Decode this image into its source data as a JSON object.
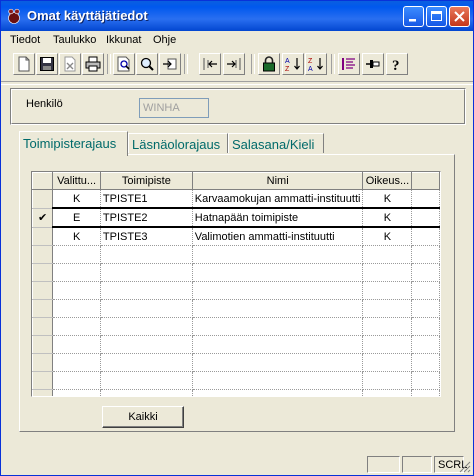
{
  "window": {
    "title": "Omat käyttäjätiedot",
    "colors": {
      "titlebar": "#0058ee",
      "tab_text": "#006a6a",
      "face": "#ece9d8"
    }
  },
  "menu": {
    "items": [
      {
        "label": "Tiedot"
      },
      {
        "label": "Taulukko"
      },
      {
        "label": "Ikkunat"
      },
      {
        "label": "Ohje"
      }
    ]
  },
  "toolbar": {
    "icons": [
      "new-icon",
      "save-icon",
      "delete-icon",
      "print-icon",
      "print-preview-icon",
      "zoom-icon",
      "goto-icon",
      "import-icon",
      "export-icon",
      "lock-icon",
      "sort-ascending-icon",
      "sort-descending-icon",
      "list-icon",
      "pin-icon",
      "help-icon"
    ]
  },
  "henkilo": {
    "label": "Henkilö",
    "value": "WINHA"
  },
  "tabs": [
    {
      "label": "Toimipisterajaus",
      "active": true
    },
    {
      "label": "Läsnäolorajaus",
      "active": false
    },
    {
      "label": "Salasana/Kieli",
      "active": false
    }
  ],
  "grid": {
    "columns": [
      "Valittu...",
      "Toimipiste",
      "Nimi",
      "Oikeus..."
    ],
    "rows": [
      {
        "indicator": "",
        "valittu": "K",
        "toimipiste": "TPISTE1",
        "nimi": "Karvaamokujan ammatti-instituutti",
        "oikeus": "K"
      },
      {
        "indicator": "✔",
        "valittu": "E",
        "toimipiste": "TPISTE2",
        "nimi": "Hatnapään toimipiste",
        "oikeus": "K"
      },
      {
        "indicator": "",
        "valittu": "K",
        "toimipiste": "TPISTE3",
        "nimi": "Valimotien ammatti-instituutti",
        "oikeus": "K"
      }
    ],
    "empty_rows": 10
  },
  "buttons": {
    "kaikki": "Kaikki"
  },
  "status": {
    "panels": [
      "",
      "",
      "SCRL"
    ]
  }
}
